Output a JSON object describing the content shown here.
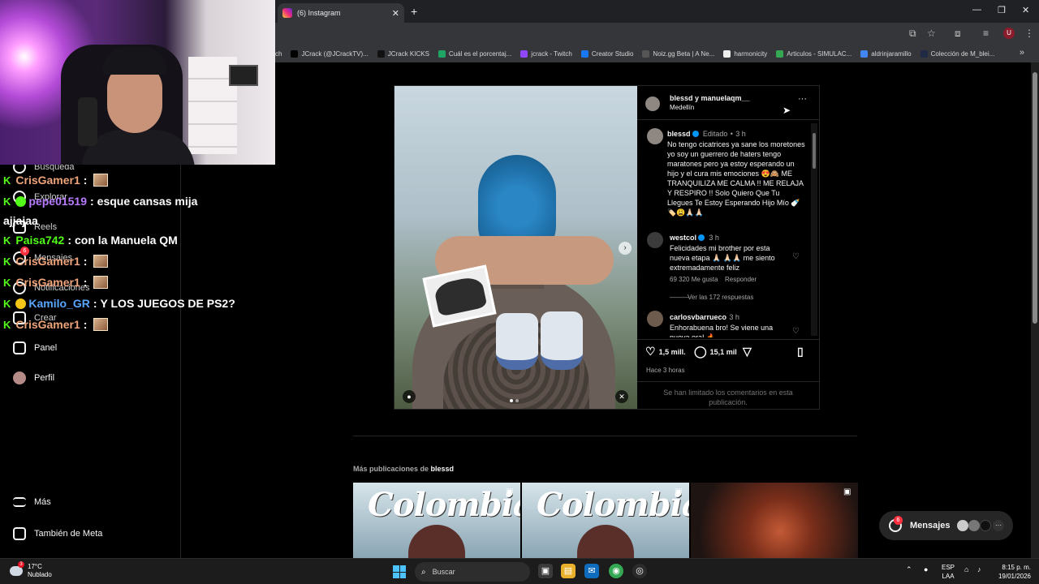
{
  "browser": {
    "tab_title": "(6) Instagram",
    "tab_close": "✕",
    "new_tab": "+",
    "window_controls": [
      "—",
      "❐",
      "✕"
    ],
    "bookmarks": [
      {
        "label": "ch",
        "color": "#35363a"
      },
      {
        "label": "JCrack (@JCrackTV)...",
        "color": "#000000"
      },
      {
        "label": "JCrack KICKS",
        "color": "#111111"
      },
      {
        "label": "Cuál es el porcentaj...",
        "color": "#1fa463"
      },
      {
        "label": "jcrack - Twitch",
        "color": "#9146ff"
      },
      {
        "label": "Creator Studio",
        "color": "#1877f2"
      },
      {
        "label": "Noiz.gg Beta | A Ne...",
        "color": "#555555"
      },
      {
        "label": "harmonicity",
        "color": "#eeeeee"
      },
      {
        "label": "Articulos - SIMULAC...",
        "color": "#34a853"
      },
      {
        "label": "aldrinjaramillo",
        "color": "#4285f4"
      },
      {
        "label": "Colección de M_blei...",
        "color": "#1f2a44"
      }
    ],
    "bookmarks_more": "»"
  },
  "sidebar": {
    "nav": [
      {
        "label": "Búsqueda"
      },
      {
        "label": "Explorar"
      },
      {
        "label": "Reels"
      },
      {
        "label": "Mensajes",
        "badge": "6"
      },
      {
        "label": "Notificaciones"
      },
      {
        "label": "Crear"
      },
      {
        "label": "Panel"
      },
      {
        "label": "Perfil"
      },
      {
        "label": "Más"
      },
      {
        "label": "También de Meta"
      }
    ]
  },
  "chat": [
    {
      "user": "CrisGamer1",
      "sep": ":",
      "msg": "",
      "color": "#f0a47a"
    },
    {
      "user": "pepe01519",
      "sep": ":",
      "msg": "esque cansas mija",
      "color": "#b77bff"
    },
    {
      "user": "",
      "sep": "",
      "msg": "ajjajaa",
      "color": "#ffffff"
    },
    {
      "user": "Paisa742",
      "sep": ":",
      "msg": "con la Manuela QM",
      "color": "#53fc18"
    },
    {
      "user": "CrisGamer1",
      "sep": ":",
      "msg": "",
      "color": "#f0a47a"
    },
    {
      "user": "CrisGamer1",
      "sep": ":",
      "msg": "",
      "color": "#f0a47a"
    },
    {
      "user": "Kamilo_GR",
      "sep": ":",
      "msg": "Y LOS JUEGOS DE PS2?",
      "color": "#59a6ff"
    },
    {
      "user": "CrisGamer1",
      "sep": ":",
      "msg": "",
      "color": "#f0a47a"
    }
  ],
  "post": {
    "header_names": "blessd y manuelaqm__",
    "location": "Medellín",
    "more": "···",
    "caption": {
      "user": "blessd",
      "edited": "Editado",
      "time": "3 h",
      "text": "No tengo cicatrices ya sane los moretones yo soy un guerrero de haters tengo maratones pero ya estoy esperando  un hijo y el cura mis emociones 😍🙈 ME TRANQUILIZA ME CALMA !! ME RELAJA Y RESPIRO !! Solo Quiero Que Tu Llegues Te Estoy Esperando Hijo Mío 🍼🏷️😩🙏🏻🙏🏻"
    },
    "comments": [
      {
        "user": "westcol",
        "time": "3 h",
        "text": "Felicidades mi brother por esta nueva etapa 🙏🏻 🙏🏻🙏🏻 me siento extremadamente feliz",
        "likes": "69 320 Me gusta",
        "reply": "Responder",
        "view_replies": "Ver las 172 respuestas"
      },
      {
        "user": "carlosvbarrueco",
        "time": "3 h",
        "text": "Enhorabuena bro! Se viene una nueva era! 🔥"
      }
    ],
    "likes": "1,5 mill.",
    "comment_count": "15,1 mil",
    "posted_ago": "Hace 3 horas",
    "limited_notice": "Se han limitado los comentarios en esta publicación."
  },
  "more_posts": {
    "prefix": "Más publicaciones de",
    "user": "blessd",
    "grid_logo": "Colombia"
  },
  "messages": {
    "label": "Mensajes",
    "badge": "6"
  },
  "taskbar": {
    "temp": "17°C",
    "weather": "Nublado",
    "weather_badge": "3",
    "search_placeholder": "Buscar",
    "lang_line1": "ESP",
    "lang_line2": "LAA",
    "time": "8:15 p. m.",
    "date": "19/01/2026"
  }
}
